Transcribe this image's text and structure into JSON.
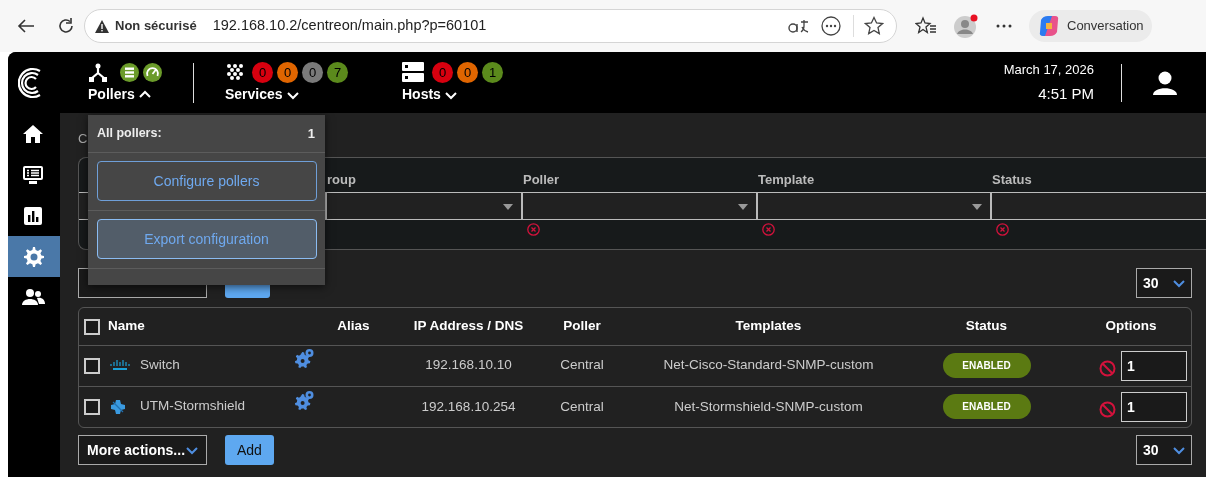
{
  "browser": {
    "warning": "Non sécurisé",
    "url": "192.168.10.2/centreon/main.php?p=60101",
    "copilot_label": "Conversation"
  },
  "header": {
    "pollers": {
      "label": "Pollers",
      "expanded": true
    },
    "services": {
      "label": "Services",
      "expanded": false,
      "counters": [
        {
          "value": "0",
          "color": "#d7000f"
        },
        {
          "value": "0",
          "color": "#e06500"
        },
        {
          "value": "0",
          "color": "#7a7a7a"
        },
        {
          "value": "7",
          "color": "#5b8a1c"
        }
      ]
    },
    "hosts": {
      "label": "Hosts",
      "expanded": false,
      "counters": [
        {
          "value": "0",
          "color": "#d7000f"
        },
        {
          "value": "0",
          "color": "#e06500"
        },
        {
          "value": "1",
          "color": "#5b8a1c"
        }
      ]
    },
    "date": "March 17, 2026",
    "time": "4:51 PM"
  },
  "sidebar": {
    "items": [
      {
        "kind": "home",
        "selected": false
      },
      {
        "kind": "monitoring",
        "selected": false
      },
      {
        "kind": "reporting",
        "selected": false
      },
      {
        "kind": "configuration",
        "selected": true
      },
      {
        "kind": "administration",
        "selected": false
      }
    ]
  },
  "breadcrumb": "C",
  "filters": {
    "columns": [
      {
        "label": "roup"
      },
      {
        "label": "Poller",
        "clear_icon": true
      },
      {
        "label": "Template",
        "clear_icon": true
      },
      {
        "label": "Status",
        "clear_icon": true
      }
    ]
  },
  "top_actions": {
    "page_size": "30"
  },
  "table": {
    "header_checked": false,
    "columns": [
      "Name",
      "Alias",
      "IP Address / DNS",
      "Poller",
      "Templates",
      "Status",
      "Options"
    ],
    "rows": [
      {
        "checked": false,
        "kind": "cisco",
        "name": "Switch",
        "ip": "192.168.10.10",
        "poller": "Central",
        "template": "Net-Cisco-Standard-SNMP-custom",
        "status": "ENABLED",
        "enabled": true,
        "option_value": "1"
      },
      {
        "checked": false,
        "kind": "stormshield",
        "name": "UTM-Stormshield",
        "ip": "192.168.10.254",
        "poller": "Central",
        "template": "Net-Stormshield-SNMP-custom",
        "status": "ENABLED",
        "enabled": true,
        "option_value": "1"
      }
    ]
  },
  "bottom_actions": {
    "more_actions": "More actions...",
    "add": "Add",
    "page_size": "30"
  },
  "pollers_menu": {
    "title": "All pollers:",
    "count": "1",
    "buttons": [
      {
        "label": "Configure pollers",
        "hovered": false
      },
      {
        "label": "Export configuration",
        "hovered": true
      }
    ]
  }
}
